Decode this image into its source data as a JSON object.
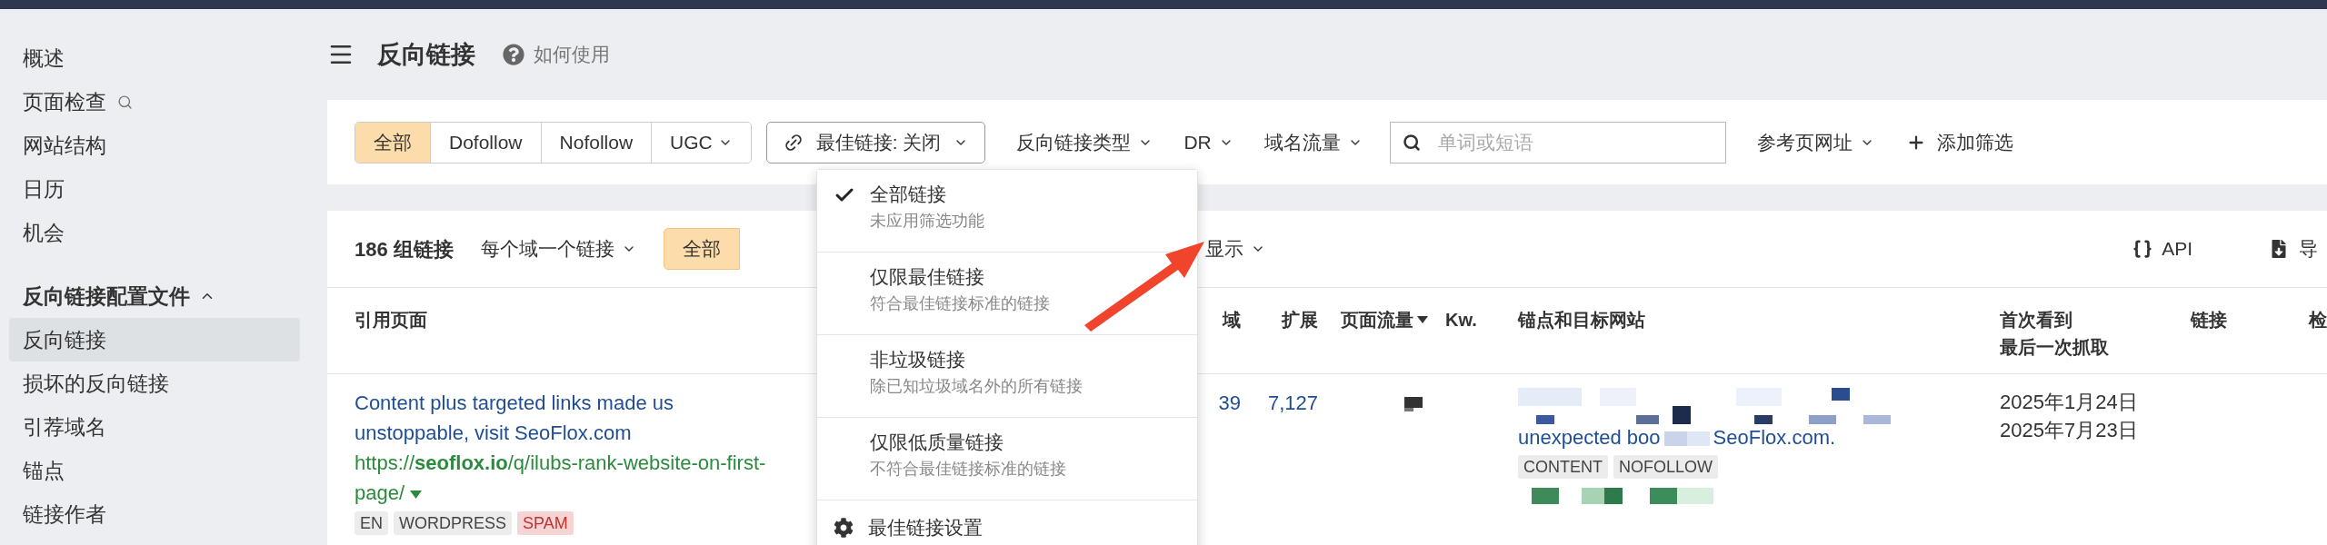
{
  "sidebar": {
    "items": [
      {
        "label": "概述",
        "selected": false
      },
      {
        "label": "页面检查",
        "selected": false,
        "kind": "search"
      },
      {
        "label": "网站结构",
        "selected": false
      },
      {
        "label": "日历",
        "selected": false
      },
      {
        "label": "机会",
        "selected": false
      }
    ],
    "section": {
      "title": "反向链接配置文件",
      "expanded": true,
      "items": [
        {
          "label": "反向链接",
          "selected": true
        },
        {
          "label": "损坏的反向链接",
          "selected": false
        },
        {
          "label": "引荐域名",
          "selected": false
        },
        {
          "label": "锚点",
          "selected": false
        },
        {
          "label": "链接作者",
          "selected": false
        }
      ]
    }
  },
  "page_header": {
    "title": "反向链接",
    "help": "如何使用"
  },
  "filters": {
    "segments": [
      {
        "label": "全部",
        "selected": true,
        "dropdown": false
      },
      {
        "label": "Dofollow",
        "selected": false,
        "dropdown": false
      },
      {
        "label": "Nofollow",
        "selected": false,
        "dropdown": false
      },
      {
        "label": "UGC",
        "selected": false,
        "dropdown": true
      }
    ],
    "best_link": {
      "label": "最佳链接: 关闭",
      "expanded": true
    },
    "controls": [
      {
        "kind": "dropdown",
        "label": "反向链接类型"
      },
      {
        "kind": "dropdown",
        "label": "DR"
      },
      {
        "kind": "dropdown",
        "label": "域名流量"
      },
      {
        "kind": "search",
        "placeholder": "单词或短语"
      },
      {
        "kind": "dropdown",
        "label": "参考页网址"
      },
      {
        "kind": "add",
        "label": "添加筛选"
      }
    ]
  },
  "best_link_menu": {
    "options": [
      {
        "title": "全部链接",
        "description": "未应用筛选功能",
        "selected": true
      },
      {
        "title": "仅限最佳链接",
        "description": "符合最佳链接标准的链接",
        "selected": false
      },
      {
        "title": "非垃圾链接",
        "description": "除已知垃圾域名外的所有链接",
        "selected": false
      },
      {
        "title": "仅限低质量链接",
        "description": "不符合最佳链接标准的链接",
        "selected": false
      }
    ],
    "settings": "最佳链接设置"
  },
  "toolbar": {
    "count": "186 组链接",
    "grouping": "每个域一个链接",
    "segment": {
      "label": "全部",
      "selected": true
    },
    "display": "显示",
    "api": "API",
    "export": "导"
  },
  "table": {
    "columns": [
      {
        "lines": [
          "引用页面"
        ],
        "sorted": false
      },
      {
        "lines": [
          "域"
        ],
        "sorted": false
      },
      {
        "lines": [
          "扩展"
        ],
        "sorted": false
      },
      {
        "lines": [
          "页面流量"
        ],
        "sorted": true
      },
      {
        "lines": [
          "Kw."
        ],
        "sorted": false
      },
      {
        "lines": [
          "锚点和目标网站"
        ],
        "sorted": false
      },
      {
        "lines": [
          "首次看到",
          "最后一次抓取"
        ],
        "sorted": false
      },
      {
        "lines": [
          "链接"
        ],
        "sorted": false
      },
      {
        "lines": [
          "检"
        ]
      }
    ],
    "rows": [
      {
        "title": "Content plus targeted links made us unstoppable, visit SeoFlox.com",
        "url": "https://**seoflox.io**/q/ilubs-rank-website-on-first-page/",
        "tags": [
          {
            "label": "EN",
            "kind": "plain"
          },
          {
            "label": "WORDPRESS",
            "kind": "plain"
          },
          {
            "label": "SPAM",
            "kind": "spam"
          }
        ],
        "domains": "39",
        "extended": "7,127",
        "anchor_parts": [
          "unexpected boo",
          "SeoFlox.com."
        ],
        "anchor_tags": [
          "CONTENT",
          "NOFOLLOW"
        ],
        "dates": [
          "2025年1月24日",
          "2025年7月23日"
        ]
      }
    ]
  }
}
